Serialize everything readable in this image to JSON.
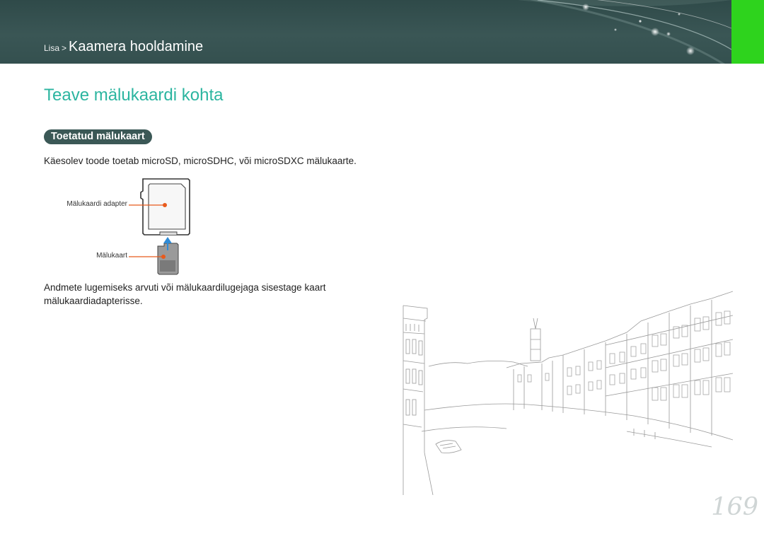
{
  "header": {
    "breadcrumb_parent": "Lisa",
    "breadcrumb_separator": ">",
    "breadcrumb_current": "Kaamera hooldamine",
    "accent_color": "#2ed31d"
  },
  "section": {
    "title": "Teave mälukaardi kohta",
    "subsection": "Toetatud mälukaart",
    "intro": "Käesolev toode toetab microSD, microSDHC, või microSDXC mälukaarte.",
    "figure": {
      "adapter_label": "Mälukaardi adapter",
      "card_label": "Mälukaart"
    },
    "instruction": "Andmete lugemiseks arvuti või mälukaardilugejaga sisestage kaart mälukaardiadapterisse."
  },
  "illustration": "city-street-sketch",
  "page_number": "169",
  "colors": {
    "title": "#2cb5a0",
    "pill": "#3b5856",
    "callout": "#e85a1c",
    "arrow": "#2f8bd6"
  }
}
